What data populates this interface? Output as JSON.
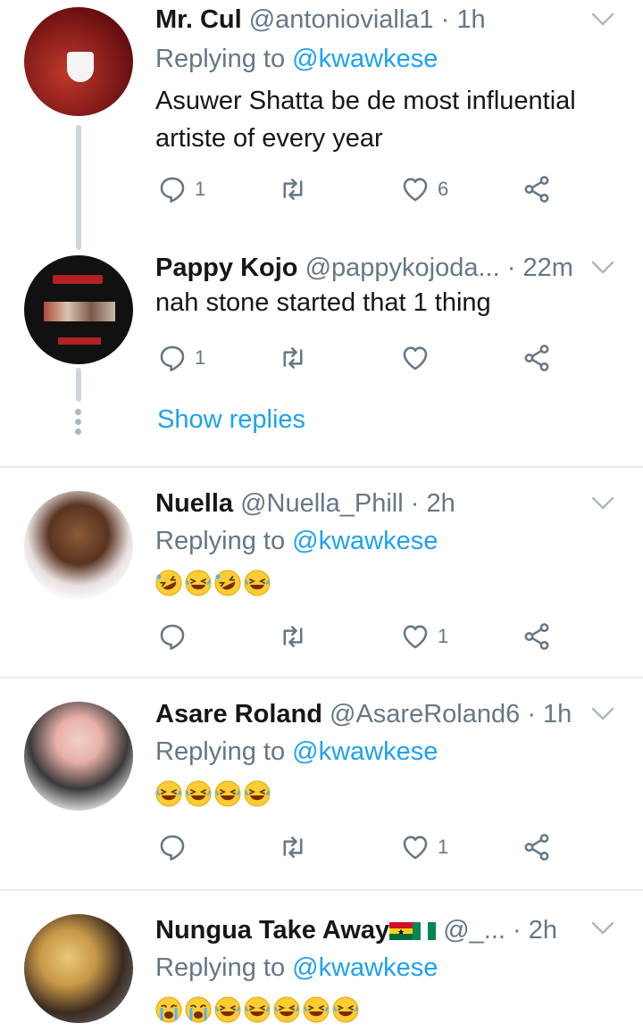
{
  "icons": {
    "reply": "reply-icon",
    "retweet": "retweet-icon",
    "like": "heart-icon",
    "share": "share-icon",
    "more": "chevron-down-icon"
  },
  "colors": {
    "link": "#1da1f2",
    "muted": "#657786",
    "line": "#ccd6dd",
    "divider": "#e6ecf0"
  },
  "tweets": [
    {
      "name": "Mr. Cul",
      "handle": "@antoniovialla1",
      "time": "1h",
      "replying_label": "Replying to",
      "replying_to": "@kwawkese",
      "text_lines": [
        "Asuwer Shatta be de most influential",
        "artiste of every year"
      ],
      "reply_count": "1",
      "retweet_count": "",
      "like_count": "6"
    },
    {
      "name": "Pappy Kojo",
      "handle": "@pappykojoda...",
      "time": "22m",
      "text_lines": [
        "nah stone started that 1 thing"
      ],
      "reply_count": "1",
      "retweet_count": "",
      "like_count": "",
      "show_replies": "Show replies"
    },
    {
      "name": "Nuella",
      "handle": "@Nuella_Phill",
      "time": "2h",
      "replying_label": "Replying to",
      "replying_to": "@kwawkese",
      "emojis": [
        "rolling-on-floor-laughing",
        "grinning-sweat",
        "rolling-on-floor-laughing",
        "grinning-sweat"
      ],
      "reply_count": "",
      "retweet_count": "",
      "like_count": "1"
    },
    {
      "name": "Asare Roland",
      "handle": "@AsareRoland6",
      "time": "1h",
      "replying_label": "Replying to",
      "replying_to": "@kwawkese",
      "emojis": [
        "grinning-sweat",
        "grinning-sweat",
        "grinning-sweat",
        "grinning-sweat"
      ],
      "reply_count": "",
      "retweet_count": "",
      "like_count": "1"
    },
    {
      "name": "Nungua Take Away",
      "handle": "@_...",
      "time": "2h",
      "flags": [
        "ghana-flag",
        "nigeria-flag"
      ],
      "replying_label": "Replying to",
      "replying_to": "@kwawkese",
      "emojis": [
        "loudly-crying",
        "loudly-crying",
        "grinning-sweat",
        "grinning-sweat",
        "grinning-sweat",
        "grinning-sweat",
        "grinning-sweat"
      ]
    }
  ]
}
